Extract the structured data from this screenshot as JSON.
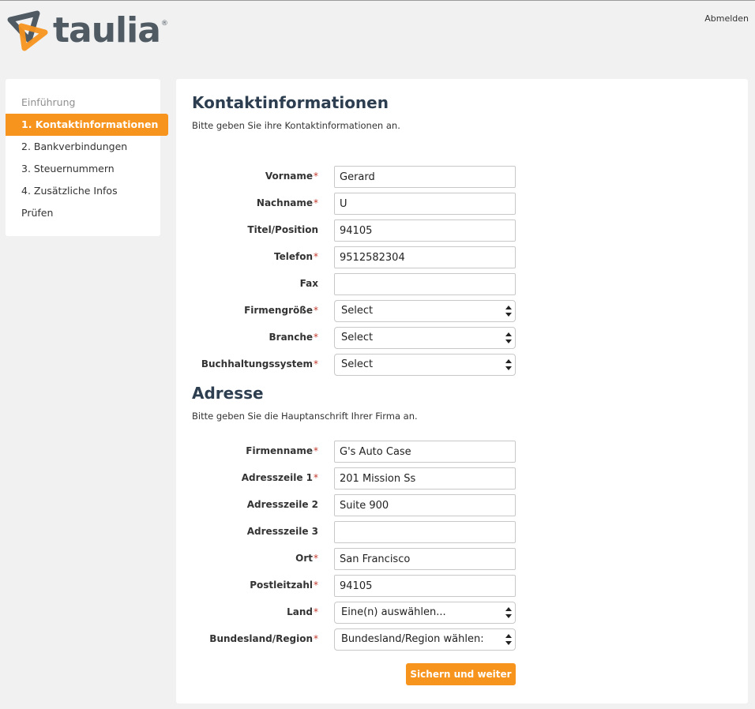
{
  "brand": {
    "name": "taulia",
    "registered": "®",
    "colors": {
      "orange": "#f7941e",
      "slate": "#4f5a63",
      "heading": "#2c3e50"
    }
  },
  "header": {
    "logout_label": "Abmelden"
  },
  "sidebar": {
    "items": [
      {
        "label": "Einführung",
        "state": "muted"
      },
      {
        "label": "1. Kontaktinformationen",
        "state": "active"
      },
      {
        "label": "2. Bankverbindungen",
        "state": "normal"
      },
      {
        "label": "3. Steuernummern",
        "state": "normal"
      },
      {
        "label": "4. Zusätzliche Infos",
        "state": "normal"
      },
      {
        "label": "Prüfen",
        "state": "normal"
      }
    ]
  },
  "contact": {
    "title": "Kontaktinformationen",
    "subtitle": "Bitte geben Sie ihre Kontaktinformationen an.",
    "fields": {
      "vorname": {
        "label": "Vorname",
        "required": "*",
        "value": "Gerard"
      },
      "nachname": {
        "label": "Nachname",
        "required": "*",
        "value": "U"
      },
      "titel": {
        "label": "Titel/Position",
        "value": "94105"
      },
      "telefon": {
        "label": "Telefon",
        "required": "*",
        "value": "9512582304"
      },
      "fax": {
        "label": "Fax",
        "value": ""
      },
      "firmengroesse": {
        "label": "Firmengröße",
        "required": "*",
        "selected": "Select"
      },
      "branche": {
        "label": "Branche",
        "required": "*",
        "selected": "Select"
      },
      "buchhaltung": {
        "label": "Buchhaltungssystem",
        "required": "*",
        "selected": "Select"
      }
    }
  },
  "address": {
    "title": "Adresse",
    "subtitle": "Bitte geben Sie die Hauptanschrift Ihrer Firma an.",
    "fields": {
      "firmenname": {
        "label": "Firmenname",
        "required": "*",
        "value": "G's Auto Case"
      },
      "zeile1": {
        "label": "Adresszeile 1",
        "required": "*",
        "value": "201 Mission Ss"
      },
      "zeile2": {
        "label": "Adresszeile 2",
        "value": "Suite 900"
      },
      "zeile3": {
        "label": "Adresszeile 3",
        "value": ""
      },
      "ort": {
        "label": "Ort",
        "required": "*",
        "value": "San Francisco"
      },
      "plz": {
        "label": "Postleitzahl",
        "required": "*",
        "value": "94105"
      },
      "land": {
        "label": "Land",
        "required": "*",
        "selected": "Eine(n) auswählen..."
      },
      "bundesland": {
        "label": "Bundesland/Region",
        "required": "*",
        "selected": "Bundesland/Region wählen:"
      }
    }
  },
  "actions": {
    "save_label": "Sichern und weiter"
  }
}
